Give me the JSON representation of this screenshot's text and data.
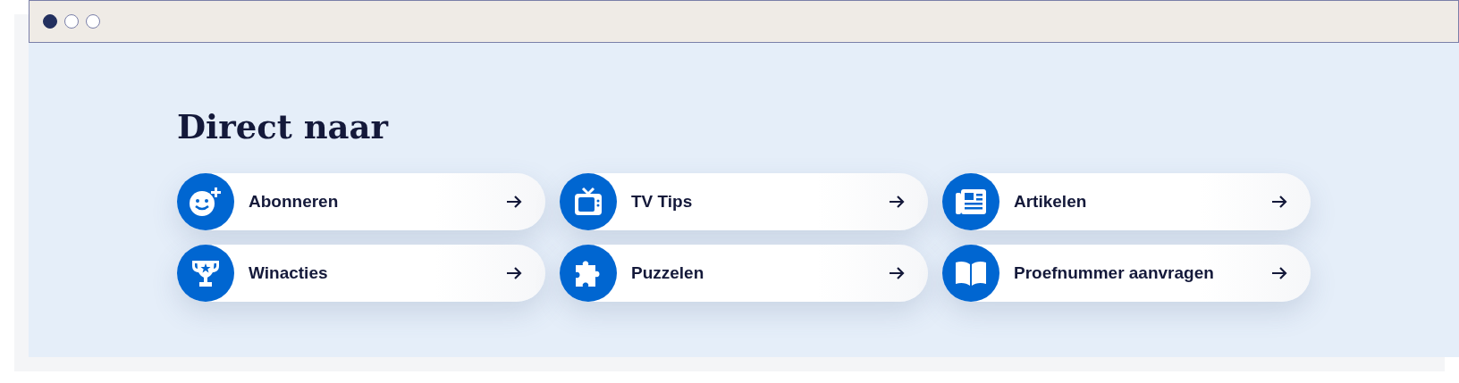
{
  "heading": "Direct naar",
  "links": [
    {
      "label": "Abonneren"
    },
    {
      "label": "TV Tips"
    },
    {
      "label": "Artikelen"
    },
    {
      "label": "Winacties"
    },
    {
      "label": "Puzzelen"
    },
    {
      "label": "Proefnummer aanvragen"
    }
  ]
}
